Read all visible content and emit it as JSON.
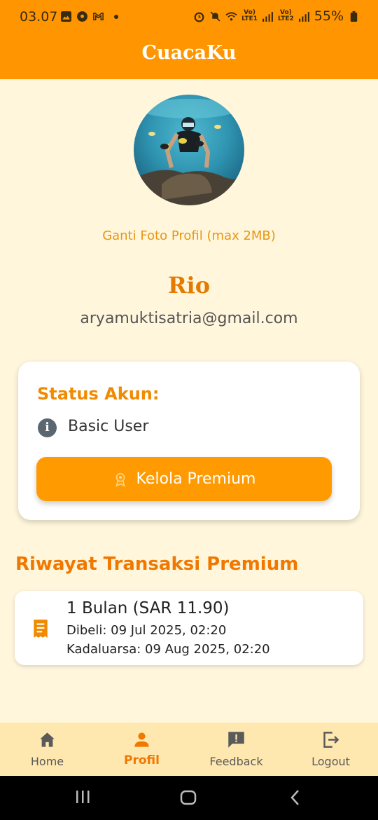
{
  "status_bar": {
    "time": "03.07",
    "left_icons": [
      "image-icon",
      "soccer-ball-icon",
      "gmail-icon"
    ],
    "battery": "55%"
  },
  "app_bar": {
    "title": "CuacaKu"
  },
  "profile": {
    "change_photo_label": "Ganti Foto Profil (max 2MB)",
    "name": "Rio",
    "email": "aryamuktisatria@gmail.com"
  },
  "status_card": {
    "label": "Status Akun:",
    "value": "Basic User",
    "button_label": "Kelola Premium"
  },
  "history": {
    "title": "Riwayat Transaksi Premium",
    "items": [
      {
        "title": "1 Bulan (SAR 11.90)",
        "bought": "Dibeli: 09 Jul 2025, 02:20",
        "expire": "Kadaluarsa: 09 Aug 2025, 02:20"
      }
    ]
  },
  "bottom_nav": {
    "items": [
      {
        "label": "Home",
        "icon": "home-icon"
      },
      {
        "label": "Profil",
        "icon": "person-icon"
      },
      {
        "label": "Feedback",
        "icon": "feedback-icon"
      },
      {
        "label": "Logout",
        "icon": "logout-icon"
      }
    ],
    "active": "Profil"
  },
  "colors": {
    "primary": "#FF9500",
    "background": "#FFF6DC",
    "nav_background": "#FFE8B0",
    "accent_text": "#F07800"
  }
}
